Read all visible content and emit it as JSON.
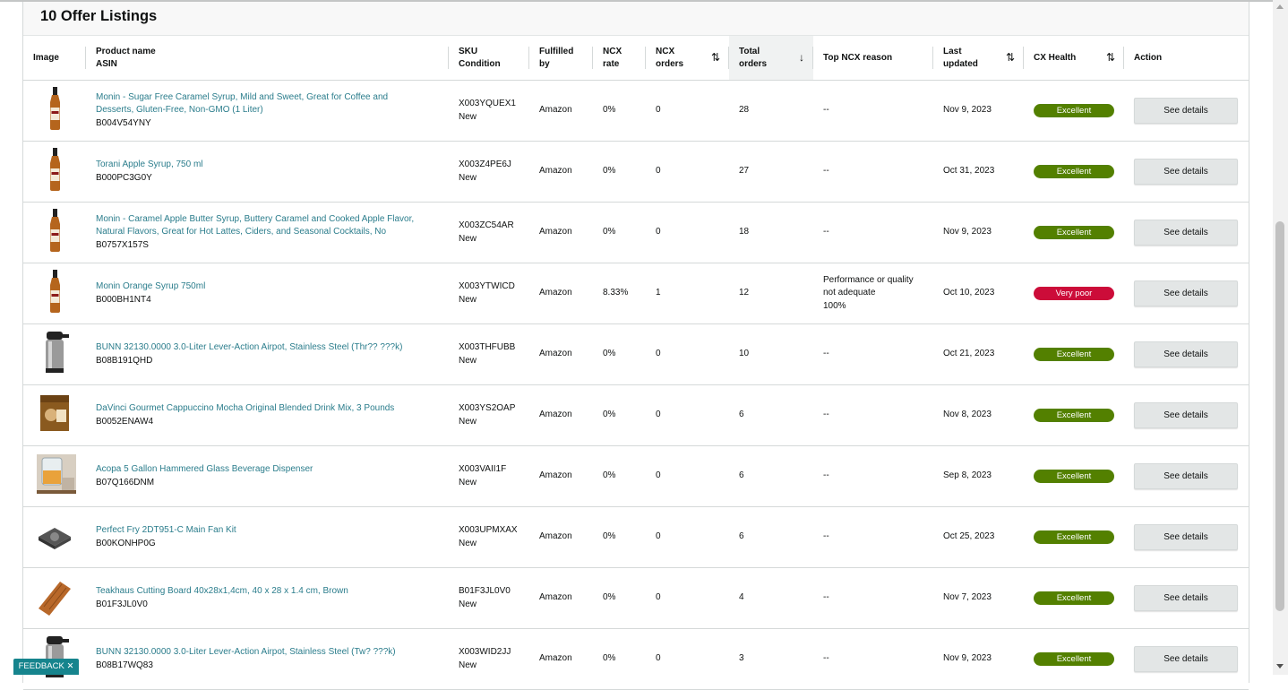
{
  "title": "10 Offer Listings",
  "columns": {
    "image": "Image",
    "product_name": "Product name",
    "asin": "ASIN",
    "sku": "SKU",
    "condition": "Condition",
    "fulfilled_by": "Fulfilled by",
    "ncx_rate": "NCX rate",
    "ncx_orders_1": "NCX",
    "ncx_orders_2": "orders",
    "total_orders_1": "Total",
    "total_orders_2": "orders",
    "top_ncx_reason": "Top NCX reason",
    "last_updated_1": "Last",
    "last_updated_2": "updated",
    "cx_health": "CX Health",
    "action": "Action"
  },
  "colors": {
    "excellent": "#538000",
    "very_poor": "#cc0c39",
    "link": "#2b7d8c"
  },
  "rows": [
    {
      "name_line1": "Monin - Sugar Free Caramel Syrup, Mild and Sweet, Great for Coffee and",
      "name_line2": "Desserts, Gluten-Free, Non-GMO (1 Liter)",
      "asin": "B004V54YNY",
      "sku": "X003YQUEX1",
      "condition": "New",
      "fulfilled": "Amazon",
      "ncx_rate": "0%",
      "ncx_orders": "0",
      "total_orders": "28",
      "reason_line1": "--",
      "reason_line2": "",
      "reason_line3": "",
      "last_updated": "Nov 9, 2023",
      "health": "Excellent",
      "health_color": "#538000",
      "action": "See details",
      "icon": "syrup-bottle-icon"
    },
    {
      "name_line1": "Torani Apple Syrup, 750 ml",
      "name_line2": "",
      "asin": "B000PC3G0Y",
      "sku": "X003Z4PE6J",
      "condition": "New",
      "fulfilled": "Amazon",
      "ncx_rate": "0%",
      "ncx_orders": "0",
      "total_orders": "27",
      "reason_line1": "--",
      "reason_line2": "",
      "reason_line3": "",
      "last_updated": "Oct 31, 2023",
      "health": "Excellent",
      "health_color": "#538000",
      "action": "See details",
      "icon": "syrup-bottle-icon"
    },
    {
      "name_line1": "Monin - Caramel Apple Butter Syrup, Buttery Caramel and Cooked Apple Flavor,",
      "name_line2": "Natural Flavors, Great for Hot Lattes, Ciders, and Seasonal Cocktails, No",
      "asin": "B0757X157S",
      "sku": "X003ZC54AR",
      "condition": "New",
      "fulfilled": "Amazon",
      "ncx_rate": "0%",
      "ncx_orders": "0",
      "total_orders": "18",
      "reason_line1": "--",
      "reason_line2": "",
      "reason_line3": "",
      "last_updated": "Nov 9, 2023",
      "health": "Excellent",
      "health_color": "#538000",
      "action": "See details",
      "icon": "syrup-bottle-icon"
    },
    {
      "name_line1": "Monin Orange Syrup 750ml",
      "name_line2": "",
      "asin": "B000BH1NT4",
      "sku": "X003YTWICD",
      "condition": "New",
      "fulfilled": "Amazon",
      "ncx_rate": "8.33%",
      "ncx_orders": "1",
      "total_orders": "12",
      "reason_line1": "Performance or quality",
      "reason_line2": "not adequate",
      "reason_line3": "100%",
      "last_updated": "Oct 10, 2023",
      "health": "Very poor",
      "health_color": "#cc0c39",
      "action": "See details",
      "icon": "syrup-bottle-icon"
    },
    {
      "name_line1": "BUNN 32130.0000 3.0-Liter Lever-Action Airpot, Stainless Steel (Thr?? ???k)",
      "name_line2": "",
      "asin": "B08B191QHD",
      "sku": "X003THFUBB",
      "condition": "New",
      "fulfilled": "Amazon",
      "ncx_rate": "0%",
      "ncx_orders": "0",
      "total_orders": "10",
      "reason_line1": "--",
      "reason_line2": "",
      "reason_line3": "",
      "last_updated": "Oct 21, 2023",
      "health": "Excellent",
      "health_color": "#538000",
      "action": "See details",
      "icon": "airpot-icon"
    },
    {
      "name_line1": "DaVinci Gourmet Cappuccino Mocha Original Blended Drink Mix, 3 Pounds",
      "name_line2": "",
      "asin": "B0052ENAW4",
      "sku": "X003YS2OAP",
      "condition": "New",
      "fulfilled": "Amazon",
      "ncx_rate": "0%",
      "ncx_orders": "0",
      "total_orders": "6",
      "reason_line1": "--",
      "reason_line2": "",
      "reason_line3": "",
      "last_updated": "Nov 8, 2023",
      "health": "Excellent",
      "health_color": "#538000",
      "action": "See details",
      "icon": "drink-mix-bag-icon"
    },
    {
      "name_line1": "Acopa 5 Gallon Hammered Glass Beverage Dispenser",
      "name_line2": "",
      "asin": "B07Q166DNM",
      "sku": "X003VAII1F",
      "condition": "New",
      "fulfilled": "Amazon",
      "ncx_rate": "0%",
      "ncx_orders": "0",
      "total_orders": "6",
      "reason_line1": "--",
      "reason_line2": "",
      "reason_line3": "",
      "last_updated": "Sep 8, 2023",
      "health": "Excellent",
      "health_color": "#538000",
      "action": "See details",
      "icon": "beverage-dispenser-icon"
    },
    {
      "name_line1": "Perfect Fry 2DT951-C Main Fan Kit",
      "name_line2": "",
      "asin": "B00KONHP0G",
      "sku": "X003UPMXAX",
      "condition": "New",
      "fulfilled": "Amazon",
      "ncx_rate": "0%",
      "ncx_orders": "0",
      "total_orders": "6",
      "reason_line1": "--",
      "reason_line2": "",
      "reason_line3": "",
      "last_updated": "Oct 25, 2023",
      "health": "Excellent",
      "health_color": "#538000",
      "action": "See details",
      "icon": "fan-kit-icon"
    },
    {
      "name_line1": "Teakhaus Cutting Board 40x28x1,4cm, 40 x 28 x 1.4 cm, Brown",
      "name_line2": "",
      "asin": "B01F3JL0V0",
      "sku": "B01F3JL0V0",
      "condition": "New",
      "fulfilled": "Amazon",
      "ncx_rate": "0%",
      "ncx_orders": "0",
      "total_orders": "4",
      "reason_line1": "--",
      "reason_line2": "",
      "reason_line3": "",
      "last_updated": "Nov 7, 2023",
      "health": "Excellent",
      "health_color": "#538000",
      "action": "See details",
      "icon": "cutting-board-icon"
    },
    {
      "name_line1": "BUNN 32130.0000 3.0-Liter Lever-Action Airpot, Stainless Steel (Tw? ???k)",
      "name_line2": "",
      "asin": "B08B17WQ83",
      "sku": "X003WID2JJ",
      "condition": "New",
      "fulfilled": "Amazon",
      "ncx_rate": "0%",
      "ncx_orders": "0",
      "total_orders": "3",
      "reason_line1": "--",
      "reason_line2": "",
      "reason_line3": "",
      "last_updated": "Nov 9, 2023",
      "health": "Excellent",
      "health_color": "#538000",
      "action": "See details",
      "icon": "airpot-icon"
    }
  ],
  "feedback": "FEEDBACK ✕"
}
